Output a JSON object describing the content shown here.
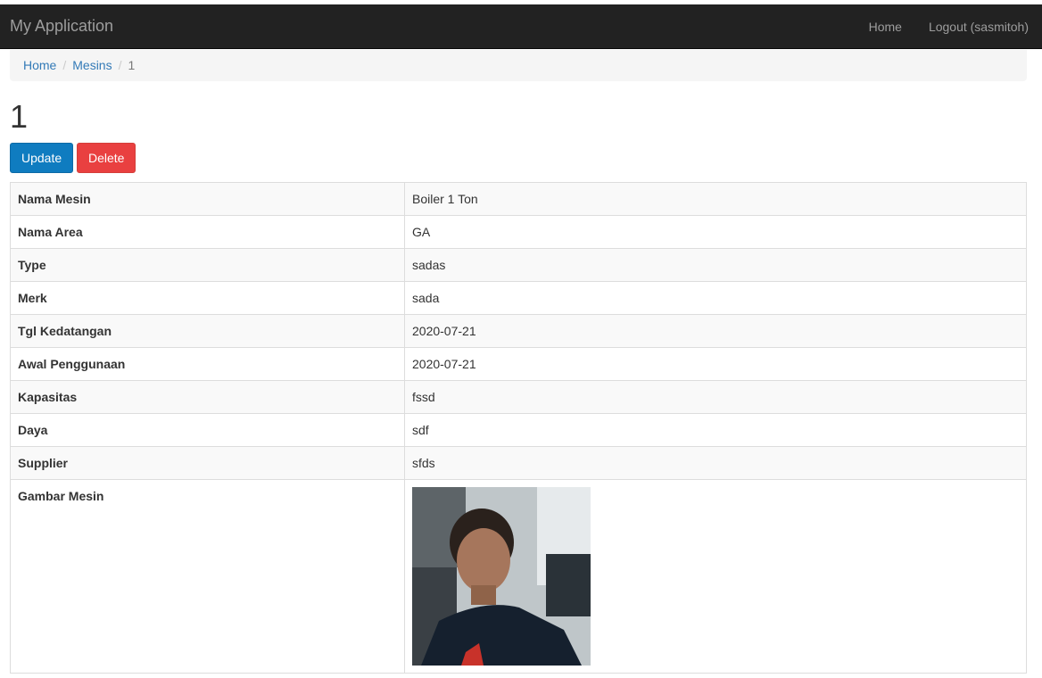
{
  "navbar": {
    "brand": "My Application",
    "links": [
      "Home",
      "Logout (sasmitoh)"
    ]
  },
  "breadcrumb": {
    "items": [
      "Home",
      "Mesins"
    ],
    "active": "1"
  },
  "page": {
    "title": "1"
  },
  "actions": {
    "update_label": "Update",
    "delete_label": "Delete"
  },
  "detail": {
    "rows": [
      {
        "label": "Nama Mesin",
        "value": "Boiler 1 Ton"
      },
      {
        "label": "Nama Area",
        "value": "GA"
      },
      {
        "label": "Type",
        "value": "sadas"
      },
      {
        "label": "Merk",
        "value": "sada"
      },
      {
        "label": "Tgl Kedatangan",
        "value": "2020-07-21"
      },
      {
        "label": "Awal Penggunaan",
        "value": "2020-07-21"
      },
      {
        "label": "Kapasitas",
        "value": "fssd"
      },
      {
        "label": "Daya",
        "value": "sdf"
      },
      {
        "label": "Supplier",
        "value": "sfds"
      }
    ],
    "image_label": "Gambar Mesin"
  },
  "colors": {
    "navbar_bg": "#222222",
    "link": "#337ab7",
    "primary": "#0f7cc0",
    "danger": "#e94040"
  }
}
